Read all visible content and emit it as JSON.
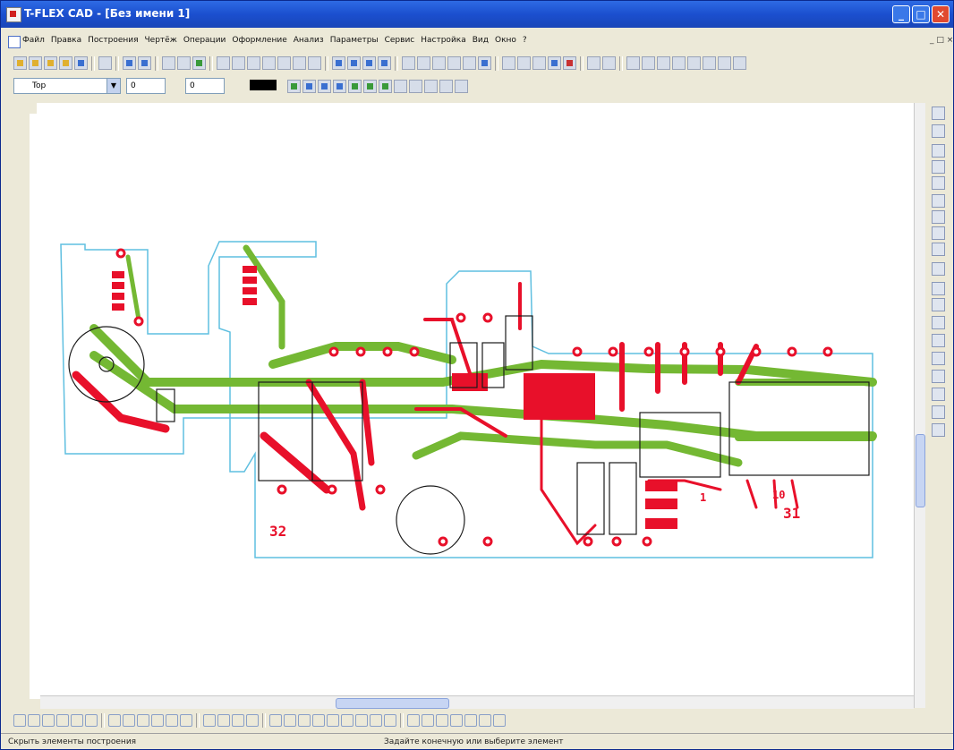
{
  "window": {
    "title": "T-FLEX CAD - [Без имени 1]",
    "min": "_",
    "max": "□",
    "close": "✕"
  },
  "menu": {
    "items": [
      "Файл",
      "Правка",
      "Построения",
      "Чертёж",
      "Операции",
      "Оформление",
      "Анализ",
      "Параметры",
      "Сервис",
      "Настройка",
      "Вид",
      "Окно",
      "?"
    ],
    "mdi_controls": "_ □ ×"
  },
  "toolbar2": {
    "layer_value": "Top",
    "field1": "0",
    "field2": "0"
  },
  "board": {
    "label_32": "32",
    "label_31": "31",
    "label_1": "1",
    "label_10": "10"
  },
  "status": {
    "left": "Скрыть элементы построения",
    "middle": "Задайте конечную или выберите элемент"
  },
  "colors": {
    "board_outline": "#5fbfe0",
    "copper_red": "#e8102a",
    "copper_green": "#74b833",
    "silk": "#1a1a1a"
  }
}
